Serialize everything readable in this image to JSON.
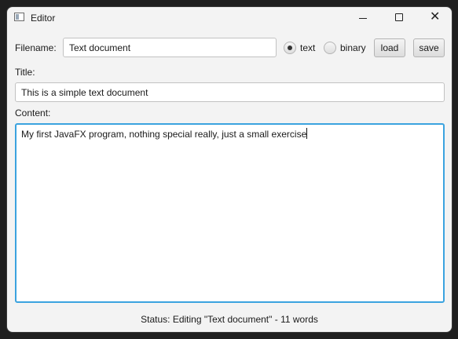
{
  "window": {
    "title": "Editor",
    "icon": "app-window-icon"
  },
  "controls": {
    "minimize": "minimize-icon",
    "maximize": "maximize-icon",
    "close": "close-icon"
  },
  "filename": {
    "label": "Filename:",
    "value": "Text document"
  },
  "format": {
    "options": [
      {
        "label": "text",
        "selected": true
      },
      {
        "label": "binary",
        "selected": false
      }
    ]
  },
  "buttons": {
    "load": "load",
    "save": "save"
  },
  "title_field": {
    "label": "Title:",
    "value": "This is a simple text document"
  },
  "content_field": {
    "label": "Content:",
    "value": "My first JavaFX program, nothing special really, just a small exercise"
  },
  "status": {
    "text": "Status: Editing \"Text document\" - 11 words"
  },
  "colors": {
    "focus": "#3ba3df",
    "window_bg": "#f3f3f3"
  }
}
